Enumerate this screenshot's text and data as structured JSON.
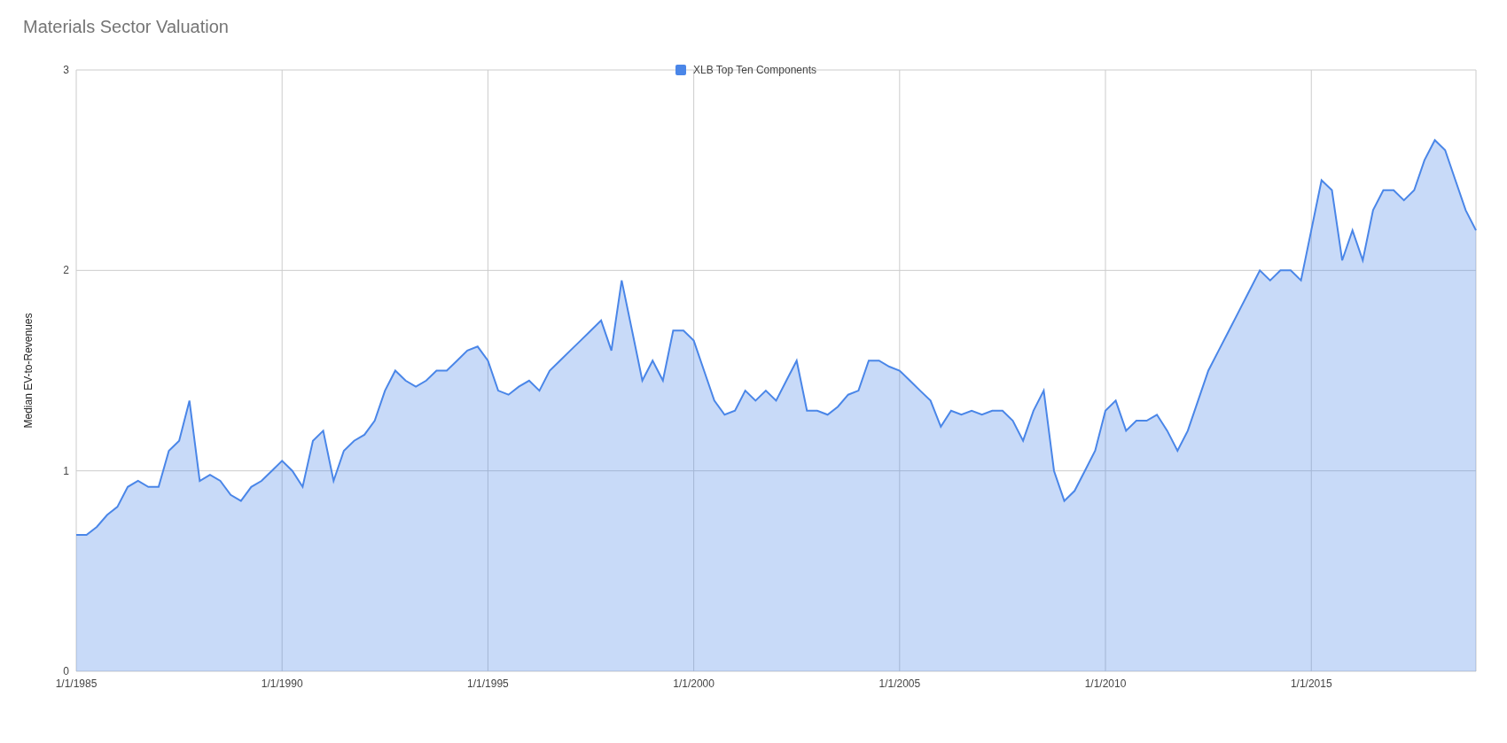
{
  "title": "Materials Sector Valuation",
  "chart": {
    "chart_data": {
      "type": "area",
      "ylabel": "Median EV-to-Revenues",
      "categories": [
        "1/1/1985",
        null,
        null,
        null,
        null,
        null,
        null,
        null,
        null,
        null,
        null,
        null,
        null,
        null,
        null,
        null,
        null,
        null,
        null,
        null,
        "1/1/1990",
        null,
        null,
        null,
        null,
        null,
        null,
        null,
        null,
        null,
        null,
        null,
        null,
        null,
        null,
        null,
        null,
        null,
        null,
        null,
        "1/1/1995",
        null,
        null,
        null,
        null,
        null,
        null,
        null,
        null,
        null,
        null,
        null,
        null,
        null,
        null,
        null,
        null,
        null,
        null,
        null,
        "1/1/2000",
        null,
        null,
        null,
        null,
        null,
        null,
        null,
        null,
        null,
        null,
        null,
        null,
        null,
        null,
        null,
        null,
        null,
        null,
        null,
        "1/1/2005",
        null,
        null,
        null,
        null,
        null,
        null,
        null,
        null,
        null,
        null,
        null,
        null,
        null,
        null,
        null,
        null,
        null,
        null,
        null,
        "1/1/2010",
        null,
        null,
        null,
        null,
        null,
        null,
        null,
        null,
        null,
        null,
        null,
        null,
        null,
        null,
        null,
        null,
        null,
        null,
        null,
        "1/1/2015",
        null,
        null,
        null,
        null,
        null,
        null,
        null,
        null,
        null,
        null,
        null,
        null,
        null,
        null,
        null,
        null
      ],
      "series": [
        {
          "name": "XLB Top Ten Components",
          "color": "#4a86e8",
          "values": [
            0.68,
            0.68,
            0.72,
            0.78,
            0.82,
            0.92,
            0.95,
            0.92,
            0.92,
            1.1,
            1.15,
            1.35,
            0.95,
            0.98,
            0.95,
            0.88,
            0.85,
            0.92,
            0.95,
            1.0,
            1.05,
            1.0,
            0.92,
            1.15,
            1.2,
            0.95,
            1.1,
            1.15,
            1.18,
            1.25,
            1.4,
            1.5,
            1.45,
            1.42,
            1.45,
            1.5,
            1.5,
            1.55,
            1.6,
            1.62,
            1.55,
            1.4,
            1.38,
            1.42,
            1.45,
            1.4,
            1.5,
            1.55,
            1.6,
            1.65,
            1.7,
            1.75,
            1.6,
            1.95,
            1.7,
            1.45,
            1.55,
            1.45,
            1.7,
            1.7,
            1.65,
            1.5,
            1.35,
            1.28,
            1.3,
            1.4,
            1.35,
            1.4,
            1.35,
            1.45,
            1.55,
            1.3,
            1.3,
            1.28,
            1.32,
            1.38,
            1.4,
            1.55,
            1.55,
            1.52,
            1.5,
            1.45,
            1.4,
            1.35,
            1.22,
            1.3,
            1.28,
            1.3,
            1.28,
            1.3,
            1.3,
            1.25,
            1.15,
            1.3,
            1.4,
            1.0,
            0.85,
            0.9,
            1.0,
            1.1,
            1.3,
            1.35,
            1.2,
            1.25,
            1.25,
            1.28,
            1.2,
            1.1,
            1.2,
            1.35,
            1.5,
            1.6,
            1.7,
            1.8,
            1.9,
            2.0,
            1.95,
            2.0,
            2.0,
            1.95,
            2.2,
            2.45,
            2.4,
            2.05,
            2.2,
            2.05,
            2.3,
            2.4,
            2.4,
            2.35,
            2.4,
            2.55,
            2.65,
            2.6,
            2.45,
            2.3,
            2.2
          ]
        }
      ],
      "ylim": [
        0,
        3
      ],
      "yticks": [
        0,
        1,
        2,
        3
      ]
    }
  }
}
